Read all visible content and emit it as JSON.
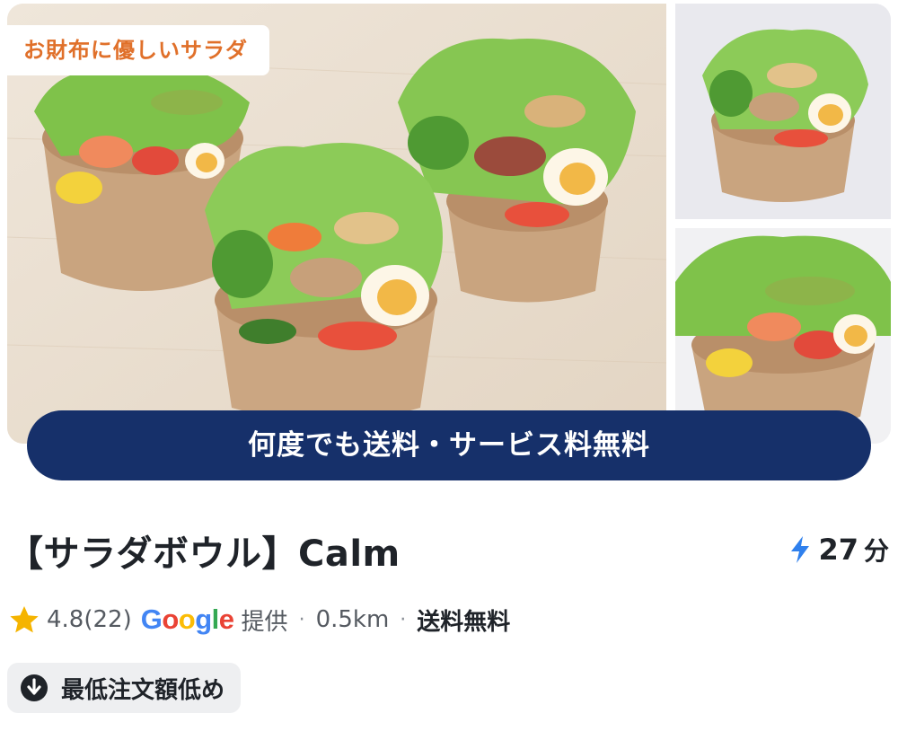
{
  "gallery": {
    "tag": "お財布に優しいサラダ",
    "promo_banner": "何度でも送料・サービス料無料",
    "images": [
      "salad-bowls-main",
      "salad-bowl-chicken",
      "salad-bowl-seafood"
    ]
  },
  "store": {
    "name": "【サラダボウル】Calm",
    "eta_value": "27",
    "eta_unit": "分",
    "eta_icon": "lightning-icon",
    "rating": "4.8",
    "review_count": "(22)",
    "google": {
      "G": "G",
      "o1": "o",
      "o2": "o",
      "g": "g",
      "l": "l",
      "e": "e"
    },
    "provided_by": "提供",
    "distance": "0.5km",
    "delivery_fee": "送料無料",
    "chip_label": "最低注文額低め",
    "chip_icon": "arrow-down-circle-icon"
  },
  "colors": {
    "promo_bg": "#16306a",
    "tag_text": "#e0702a",
    "star": "#f5b400",
    "lightning": "#2f80ed",
    "chip_bg": "#eeeff1"
  }
}
